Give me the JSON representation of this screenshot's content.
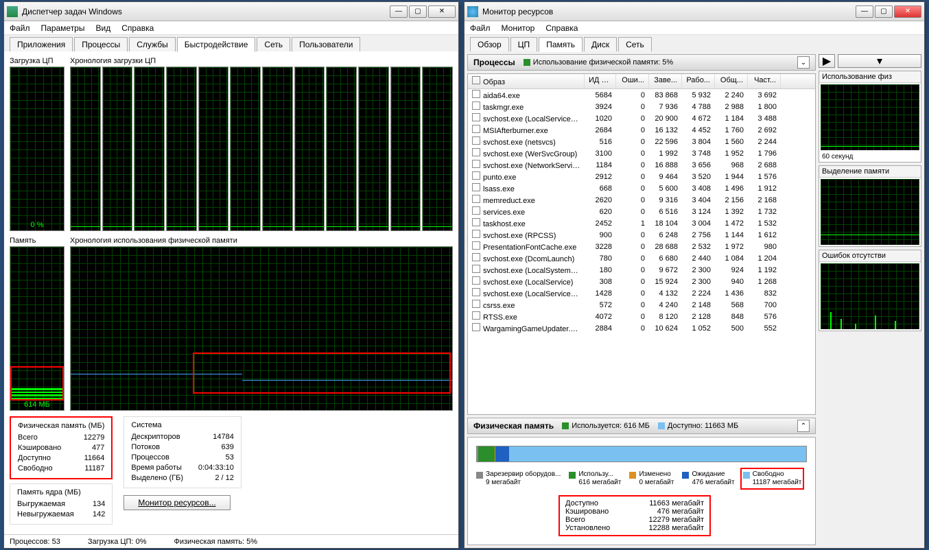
{
  "taskmgr": {
    "title": "Диспетчер задач Windows",
    "menu": [
      "Файл",
      "Параметры",
      "Вид",
      "Справка"
    ],
    "tabs": [
      "Приложения",
      "Процессы",
      "Службы",
      "Быстродействие",
      "Сеть",
      "Пользователи"
    ],
    "active_tab": 3,
    "cpu_label": "Загрузка ЦП",
    "cpu_hist_label": "Хронология загрузки ЦП",
    "cpu_value": "0 %",
    "mem_label": "Память",
    "mem_hist_label": "Хронология использования физической памяти",
    "mem_value": "614 МБ",
    "phys_mem": {
      "title": "Физическая память (МБ)",
      "rows": [
        [
          "Всего",
          "12279"
        ],
        [
          "Кэшировано",
          "477"
        ],
        [
          "Доступно",
          "11664"
        ],
        [
          "Свободно",
          "11187"
        ]
      ]
    },
    "system": {
      "title": "Система",
      "rows": [
        [
          "Дескрипторов",
          "14784"
        ],
        [
          "Потоков",
          "639"
        ],
        [
          "Процессов",
          "53"
        ],
        [
          "Время работы",
          "0:04:33:10"
        ],
        [
          "Выделено (ГБ)",
          "2 / 12"
        ]
      ]
    },
    "kernel_mem": {
      "title": "Память ядра (МБ)",
      "rows": [
        [
          "Выгружаемая",
          "134"
        ],
        [
          "Невыгружаемая",
          "142"
        ]
      ]
    },
    "resmon_btn": "Монитор ресурсов...",
    "status": {
      "procs": "Процессов: 53",
      "cpu": "Загрузка ЦП: 0%",
      "mem": "Физическая память: 5%"
    }
  },
  "resmon": {
    "title": "Монитор ресурсов",
    "menu": [
      "Файл",
      "Монитор",
      "Справка"
    ],
    "tabs": [
      "Обзор",
      "ЦП",
      "Память",
      "Диск",
      "Сеть"
    ],
    "active_tab": 2,
    "processes_hdr": "Процессы",
    "processes_info": "Использование физической памяти: 5%",
    "columns": [
      "Образ",
      "ИД п...",
      "Оши...",
      "Заве...",
      "Рабо...",
      "Общ...",
      "Част..."
    ],
    "rows": [
      [
        "aida64.exe",
        "5684",
        "0",
        "83 868",
        "5 932",
        "2 240",
        "3 692"
      ],
      [
        "taskmgr.exe",
        "3924",
        "0",
        "7 936",
        "4 788",
        "2 988",
        "1 800"
      ],
      [
        "svchost.exe (LocalServiceNet...",
        "1020",
        "0",
        "20 900",
        "4 672",
        "1 184",
        "3 488"
      ],
      [
        "MSIAfterburner.exe",
        "2684",
        "0",
        "16 132",
        "4 452",
        "1 760",
        "2 692"
      ],
      [
        "svchost.exe (netsvcs)",
        "516",
        "0",
        "22 596",
        "3 804",
        "1 560",
        "2 244"
      ],
      [
        "svchost.exe (WerSvcGroup)",
        "3100",
        "0",
        "1 992",
        "3 748",
        "1 952",
        "1 796"
      ],
      [
        "svchost.exe (NetworkService)",
        "1184",
        "0",
        "16 888",
        "3 656",
        "968",
        "2 688"
      ],
      [
        "punto.exe",
        "2912",
        "0",
        "9 464",
        "3 520",
        "1 944",
        "1 576"
      ],
      [
        "lsass.exe",
        "668",
        "0",
        "5 600",
        "3 408",
        "1 496",
        "1 912"
      ],
      [
        "memreduct.exe",
        "2620",
        "0",
        "9 316",
        "3 404",
        "2 156",
        "2 168"
      ],
      [
        "services.exe",
        "620",
        "0",
        "6 516",
        "3 124",
        "1 392",
        "1 732"
      ],
      [
        "taskhost.exe",
        "2452",
        "1",
        "18 104",
        "3 004",
        "1 472",
        "1 532"
      ],
      [
        "svchost.exe (RPCSS)",
        "900",
        "0",
        "6 248",
        "2 756",
        "1 144",
        "1 612"
      ],
      [
        "PresentationFontCache.exe",
        "3228",
        "0",
        "28 688",
        "2 532",
        "1 972",
        "980"
      ],
      [
        "svchost.exe (DcomLaunch)",
        "780",
        "0",
        "6 680",
        "2 440",
        "1 084",
        "1 204"
      ],
      [
        "svchost.exe (LocalSystemNet...",
        "180",
        "0",
        "9 672",
        "2 300",
        "924",
        "1 192"
      ],
      [
        "svchost.exe (LocalService)",
        "308",
        "0",
        "15 924",
        "2 300",
        "940",
        "1 268"
      ],
      [
        "svchost.exe (LocalServiceNo...",
        "1428",
        "0",
        "4 132",
        "2 224",
        "1 436",
        "832"
      ],
      [
        "csrss.exe",
        "572",
        "0",
        "4 240",
        "2 148",
        "568",
        "700"
      ],
      [
        "RTSS.exe",
        "4072",
        "0",
        "8 120",
        "2 128",
        "848",
        "576"
      ],
      [
        "WargamingGameUpdater.exe",
        "2884",
        "0",
        "10 624",
        "1 052",
        "500",
        "552"
      ]
    ],
    "physmem_hdr": "Физическая память",
    "physmem_used": "Используется: 616 МБ",
    "physmem_avail": "Доступно: 11663 МБ",
    "legend": [
      {
        "color": "#888",
        "label": "Зарезервир оборудов...",
        "value": "9 мегабайт"
      },
      {
        "color": "#2a8f2a",
        "label": "Использу...",
        "value": "616 мегабайт"
      },
      {
        "color": "#e09020",
        "label": "Изменено",
        "value": "0 мегабайт"
      },
      {
        "color": "#2060c0",
        "label": "Ожидание",
        "value": "476 мегабайт"
      },
      {
        "color": "#7ac0f0",
        "label": "Свободно",
        "value": "11187 мегабайт"
      }
    ],
    "summary": [
      [
        "Доступно",
        "11663 мегабайт"
      ],
      [
        "Кэшировано",
        "476 мегабайт"
      ],
      [
        "Всего",
        "12279 мегабайт"
      ],
      [
        "Установлено",
        "12288 мегабайт"
      ]
    ],
    "side": {
      "chart1": "Использование физ",
      "sec60": "60 секунд",
      "chart2": "Выделение памяти",
      "chart3": "Ошибок отсутстви"
    }
  }
}
